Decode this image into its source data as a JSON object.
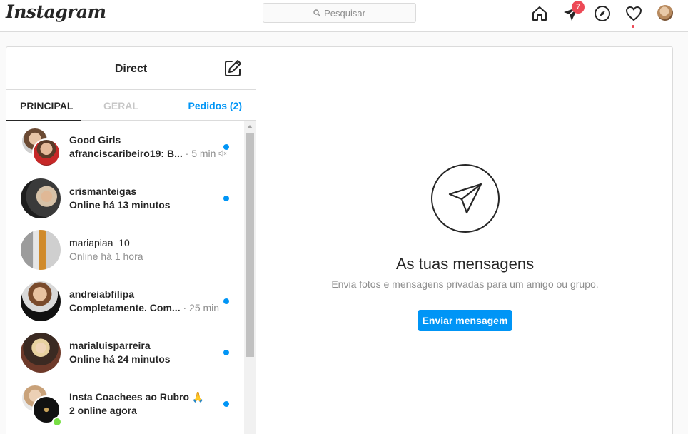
{
  "app": {
    "logo": "Instagram"
  },
  "search": {
    "placeholder": "Pesquisar"
  },
  "nav": {
    "direct_badge": "7"
  },
  "colors": {
    "accent": "#0095f6",
    "badge": "#ed4956",
    "online": "#78de45"
  },
  "direct": {
    "title": "Direct",
    "tabs": [
      {
        "label": "PRINCIPAL",
        "active": true
      },
      {
        "label": "GERAL",
        "active": false
      },
      {
        "label": "Pedidos (2)",
        "active": false
      }
    ],
    "threads": [
      {
        "name": "Good Girls",
        "preview": "afranciscaribeiro19: B...",
        "time": "· 5 min",
        "muted": true,
        "unread": true,
        "group": true
      },
      {
        "name": "crismanteigas",
        "preview": "Online há 13 minutos",
        "time": "",
        "unread": true
      },
      {
        "name": "mariapiaa_10",
        "preview": "Online há 1 hora",
        "time": "",
        "unread": false
      },
      {
        "name": "andreiabfilipa",
        "preview": "Completamente. Com...",
        "time": "· 25 min",
        "unread": true
      },
      {
        "name": "marialuisparreira",
        "preview": "Online há 24 minutos",
        "time": "",
        "unread": true
      },
      {
        "name": "Insta Coachees ao Rubro 🙏",
        "preview": "2 online agora",
        "time": "",
        "unread": true,
        "group": true,
        "online": true
      }
    ]
  },
  "empty_state": {
    "title": "As tuas mensagens",
    "description": "Envia fotos e mensagens privadas para um amigo ou grupo.",
    "button": "Enviar mensagem"
  }
}
